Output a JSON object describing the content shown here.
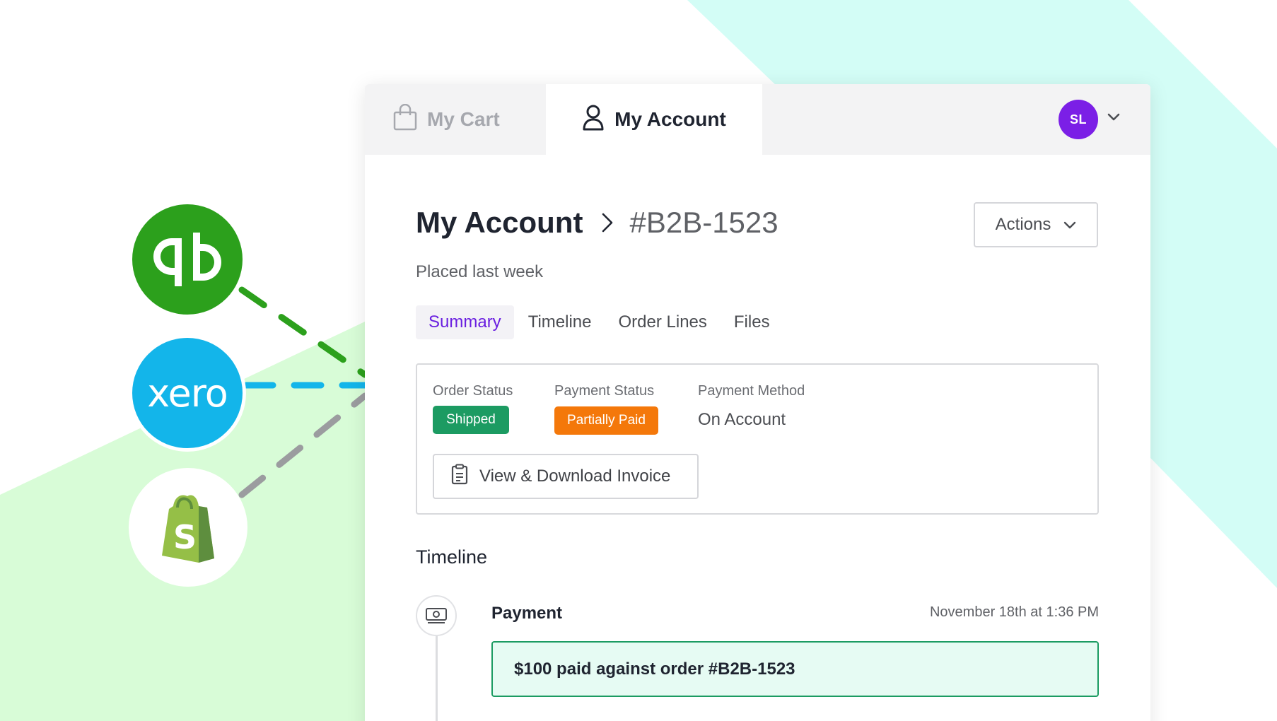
{
  "colors": {
    "accent_purple": "#6a1fe0",
    "avatar_bg": "#7b1fe6",
    "shipped_green": "#1c9b62",
    "partially_paid_orange": "#f4780a",
    "quickbooks_green": "#2ca01c",
    "xero_blue": "#13b5ea",
    "shopify_green": "#95bf47",
    "bg_mint": "#d3fdf6",
    "bg_lightgreen": "#d8fcd7"
  },
  "integrations": [
    {
      "name": "quickbooks",
      "icon": "quickbooks-logo-icon"
    },
    {
      "name": "xero",
      "logo_text": "xero"
    },
    {
      "name": "shopify",
      "icon": "shopify-logo-icon"
    }
  ],
  "topbar": {
    "cart_label": "My Cart",
    "account_label": "My Account",
    "avatar_initials": "SL"
  },
  "header": {
    "breadcrumb_title": "My Account",
    "order_id": "#B2B-1523",
    "placed": "Placed last week",
    "actions_label": "Actions"
  },
  "tabs": [
    {
      "label": "Summary",
      "active": true
    },
    {
      "label": "Timeline",
      "active": false
    },
    {
      "label": "Order Lines",
      "active": false
    },
    {
      "label": "Files",
      "active": false
    }
  ],
  "summary": {
    "order_status_label": "Order Status",
    "order_status_value": "Shipped",
    "payment_status_label": "Payment Status",
    "payment_status_value": "Partially Paid",
    "payment_method_label": "Payment Method",
    "payment_method_value": "On Account",
    "invoice_button": "View & Download Invoice"
  },
  "timeline": {
    "heading": "Timeline",
    "events": [
      {
        "title": "Payment",
        "time": "November 18th at 1:36 PM",
        "note": "$100 paid against order #B2B-1523",
        "icon": "banknote-icon"
      }
    ]
  }
}
